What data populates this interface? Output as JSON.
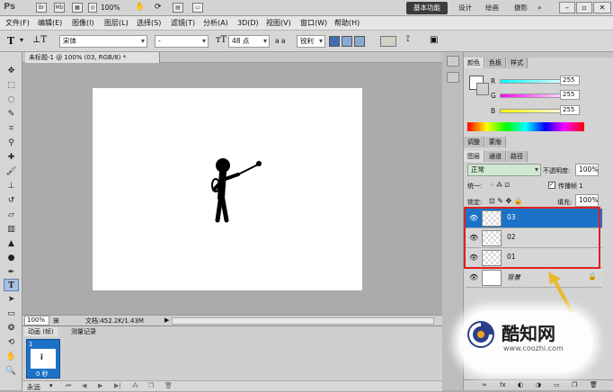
{
  "app": {
    "logo": "Ps",
    "mb_icon": "Mb",
    "zoom_level": "100%",
    "workspace_active": "基本功能",
    "workspaces": [
      "设计",
      "绘画",
      "摄影"
    ],
    "more_label": "»"
  },
  "menus": [
    "文件(F)",
    "编辑(E)",
    "图像(I)",
    "图层(L)",
    "选择(S)",
    "滤镜(T)",
    "分析(A)",
    "3D(D)",
    "视图(V)",
    "窗口(W)",
    "帮助(H)"
  ],
  "options": {
    "font_family": "宋体",
    "font_style": "-",
    "font_size": "48 点",
    "aa_label": "a a",
    "aa_value": "锐利"
  },
  "document": {
    "tab_title": "未标题-1 @ 100% (03, RGB/8) *",
    "status_zoom": "100%",
    "status_doc": "文档:452.2K/1.43M"
  },
  "animation": {
    "tab_animation": "动画 (帧)",
    "tab_log": "测量记录",
    "frame_number": "1",
    "frame_delay": "0 秒",
    "loop": "永远"
  },
  "color_panel": {
    "tabs": [
      "颜色",
      "色板",
      "样式"
    ],
    "r_label": "R",
    "r_value": "255",
    "g_label": "G",
    "g_value": "255",
    "b_label": "B",
    "b_value": "255"
  },
  "adjust_tabs": [
    "调整",
    "蒙版"
  ],
  "layers_panel": {
    "tabs": [
      "图层",
      "通道",
      "路径"
    ],
    "blend_mode": "正常",
    "opacity_label": "不透明度:",
    "opacity_value": "100%",
    "unify_label": "统一:",
    "propagate_label": "传播帧 1",
    "lock_label": "锁定:",
    "fill_label": "填充:",
    "fill_value": "100%",
    "layers": [
      {
        "name": "03",
        "selected": true
      },
      {
        "name": "02",
        "selected": false
      },
      {
        "name": "01",
        "selected": false
      },
      {
        "name": "背景",
        "selected": false
      }
    ]
  },
  "watermark": {
    "brand": "酷知网",
    "url": "www.coozhi.com"
  },
  "colors": {
    "selection_blue": "#1c72c7",
    "highlight_red": "#e02020",
    "arrow_yellow": "#e8b830"
  }
}
